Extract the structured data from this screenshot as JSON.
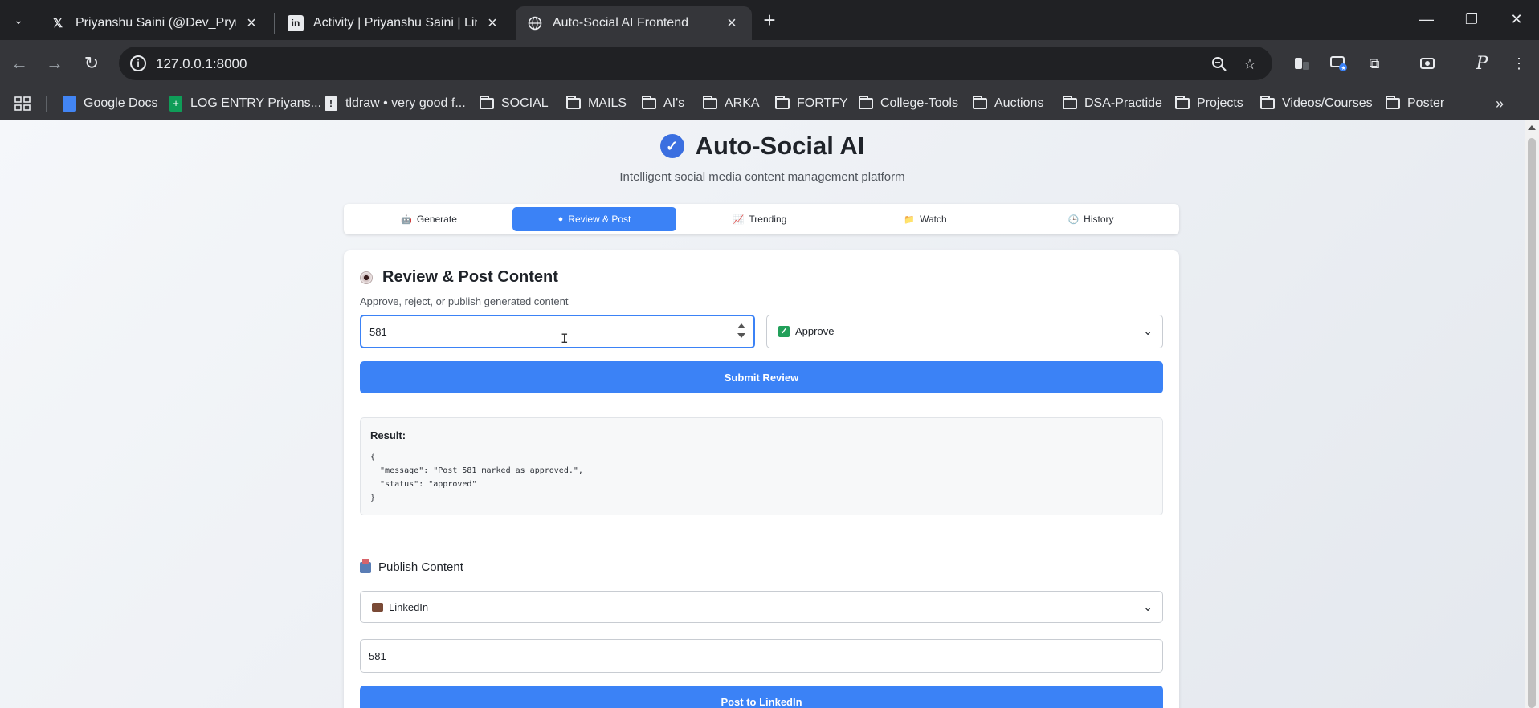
{
  "browser": {
    "tabs": [
      {
        "title": "Priyanshu Saini (@Dev_Prynshu",
        "icon": "x-logo-icon"
      },
      {
        "title": "Activity | Priyanshu Saini | Linke",
        "icon": "linkedin-icon"
      },
      {
        "title": "Auto-Social AI Frontend",
        "icon": "globe-icon"
      }
    ],
    "url": "127.0.0.1:8000",
    "bookmarks": [
      "Google Docs",
      "LOG ENTRY Priyans...",
      "tldraw • very good f...",
      "SOCIAL",
      "MAILS",
      "AI's",
      "ARKA",
      "FORTFY",
      "College-Tools",
      "Auctions",
      "DSA-Practide",
      "Projects",
      "Videos/Courses",
      "Poster"
    ]
  },
  "app": {
    "title": "Auto-Social AI",
    "subtitle": "Intelligent social media content management platform",
    "tabs": [
      "Generate",
      "Review & Post",
      "Trending",
      "Watch",
      "History"
    ],
    "active_tab": "Review & Post",
    "accent_color": "#3b82f6"
  },
  "review": {
    "title": "Review & Post Content",
    "subtitle": "Approve, reject, or publish generated content",
    "post_id": "581",
    "action": "Approve",
    "submit_label": "Submit Review",
    "result_label": "Result:",
    "result_json": "{\n  \"message\": \"Post 581 marked as approved.\",\n  \"status\": \"approved\"\n}"
  },
  "publish": {
    "title": "Publish Content",
    "platform": "LinkedIn",
    "post_id": "581",
    "button_label": "Post to LinkedIn"
  }
}
